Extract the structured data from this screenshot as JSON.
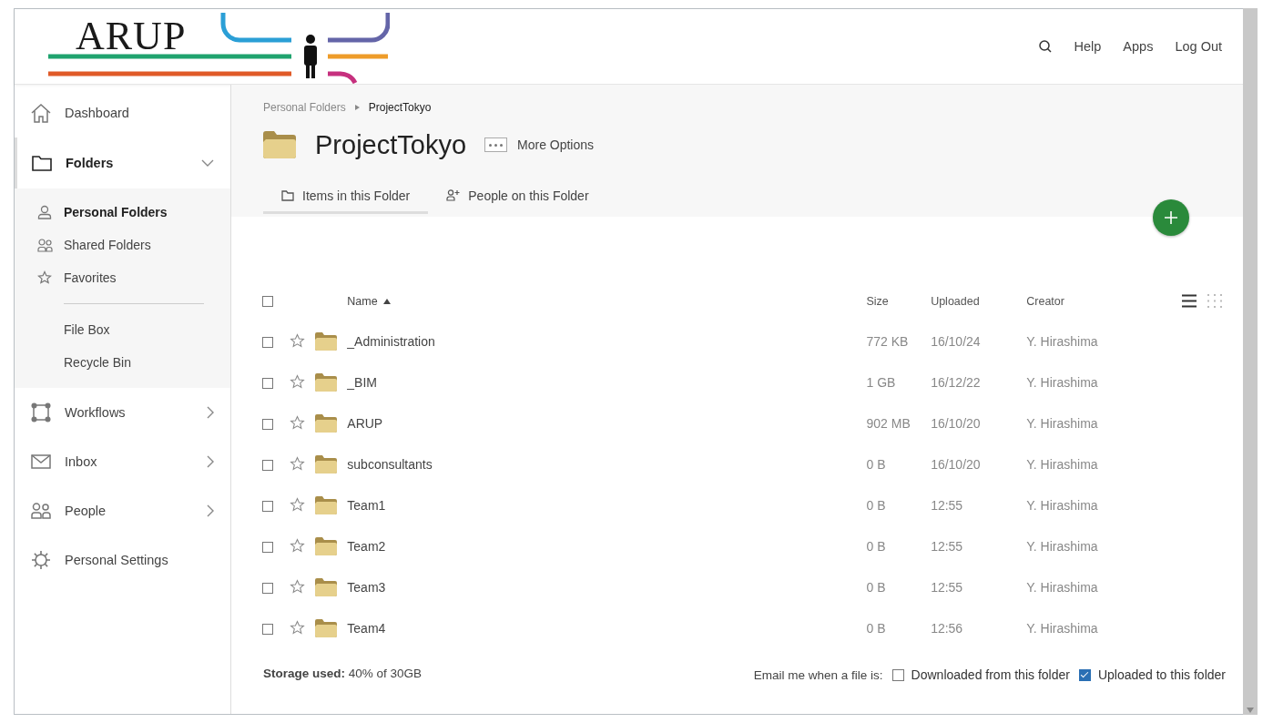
{
  "header": {
    "logo": "ARUP",
    "links": [
      "Help",
      "Apps",
      "Log Out"
    ]
  },
  "sidebar": {
    "items": [
      {
        "label": "Dashboard",
        "kind": "link",
        "selected": false
      },
      {
        "label": "Folders",
        "kind": "group",
        "selected": true,
        "expanded": true,
        "children": [
          {
            "label": "Personal Folders",
            "kind": "icon-link",
            "selected": true
          },
          {
            "label": "Shared Folders",
            "kind": "icon-link",
            "selected": false
          },
          {
            "label": "Favorites",
            "kind": "icon-link",
            "selected": false
          },
          {
            "label": "File Box",
            "kind": "plain-link",
            "selected": false
          },
          {
            "label": "Recycle Bin",
            "kind": "plain-link",
            "selected": false
          }
        ]
      },
      {
        "label": "Workflows",
        "kind": "group",
        "selected": false,
        "expanded": false
      },
      {
        "label": "Inbox",
        "kind": "group",
        "selected": false,
        "expanded": false
      },
      {
        "label": "People",
        "kind": "group",
        "selected": false,
        "expanded": false
      },
      {
        "label": "Personal Settings",
        "kind": "link",
        "selected": false
      }
    ]
  },
  "breadcrumb": [
    "Personal Folders",
    "ProjectTokyo"
  ],
  "folder": {
    "title": "ProjectTokyo",
    "more_options": "More Options"
  },
  "tabs": [
    {
      "label": "Items in this Folder",
      "selected": true
    },
    {
      "label": "People on this Folder",
      "selected": false
    }
  ],
  "table": {
    "all_checked": false,
    "columns": [
      {
        "label": "Name",
        "sorted": true
      },
      {
        "label": "Size",
        "sorted": false
      },
      {
        "label": "Uploaded",
        "sorted": false
      },
      {
        "label": "Creator",
        "sorted": false
      }
    ],
    "view_modes": [
      {
        "selected": true
      },
      {
        "selected": false
      }
    ],
    "rows": [
      {
        "name": "_Administration",
        "size": "772 KB",
        "uploaded": "16/10/24",
        "creator": "Y. Hirashima",
        "checked": false,
        "starred": false
      },
      {
        "name": "_BIM",
        "size": "1 GB",
        "uploaded": "16/12/22",
        "creator": "Y. Hirashima",
        "checked": false,
        "starred": false
      },
      {
        "name": "ARUP",
        "size": "902 MB",
        "uploaded": "16/10/20",
        "creator": "Y. Hirashima",
        "checked": false,
        "starred": false
      },
      {
        "name": "subconsultants",
        "size": "0 B",
        "uploaded": "16/10/20",
        "creator": "Y. Hirashima",
        "checked": false,
        "starred": false
      },
      {
        "name": "Team1",
        "size": "0 B",
        "uploaded": "12:55",
        "creator": "Y. Hirashima",
        "checked": false,
        "starred": false
      },
      {
        "name": "Team2",
        "size": "0 B",
        "uploaded": "12:55",
        "creator": "Y. Hirashima",
        "checked": false,
        "starred": false
      },
      {
        "name": "Team3",
        "size": "0 B",
        "uploaded": "12:55",
        "creator": "Y. Hirashima",
        "checked": false,
        "starred": false
      },
      {
        "name": "Team4",
        "size": "0 B",
        "uploaded": "12:56",
        "creator": "Y. Hirashima",
        "checked": false,
        "starred": false
      }
    ]
  },
  "footer": {
    "storage": "**Storage used:** 40% of 30GB",
    "email_label": "Email me when a file is:",
    "email_options": [
      {
        "label": "Downloaded from this folder",
        "checked": false
      },
      {
        "label": "Uploaded to this folder",
        "checked": true
      }
    ]
  }
}
